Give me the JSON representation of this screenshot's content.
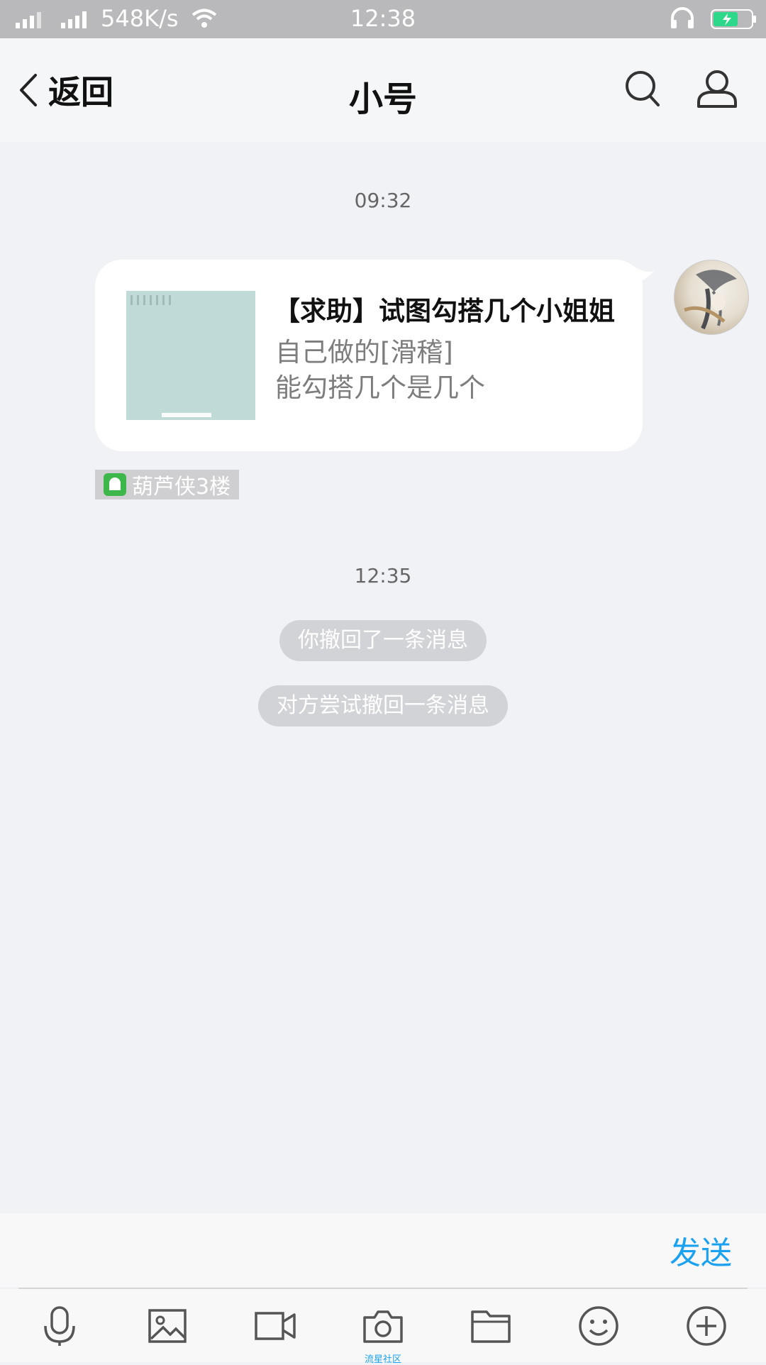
{
  "status_bar": {
    "net_speed": "548K/s",
    "time": "12:38"
  },
  "nav": {
    "back_label": "返回",
    "title": "小号"
  },
  "chat": {
    "timestamp_1": "09:32",
    "message": {
      "title": "【求助】试图勾搭几个小姐姐",
      "desc_line_1": "自己做的[滑稽]",
      "desc_line_2": "能勾搭几个是几个"
    },
    "member_title": "葫芦侠3楼",
    "timestamp_2": "12:35",
    "system_1": "你撤回了一条消息",
    "system_2": "对方尝试撤回一条消息"
  },
  "input": {
    "value": "",
    "send_label": "发送"
  },
  "toolbar": {
    "camera_caption": "流星社区"
  },
  "colors": {
    "accent": "#1aa1f0",
    "status_bar_bg": "#b9b9bb",
    "chat_bg": "#f1f2f5",
    "battery_fill": "#2dd88a"
  },
  "icons": [
    "signal-icon",
    "wifi-icon",
    "headphone-icon",
    "battery-icon",
    "back-chevron-icon",
    "search-icon",
    "profile-icon",
    "chat-title-badge-icon",
    "microphone-icon",
    "image-icon",
    "video-icon",
    "camera-icon",
    "folder-icon",
    "emoji-icon",
    "plus-icon"
  ]
}
